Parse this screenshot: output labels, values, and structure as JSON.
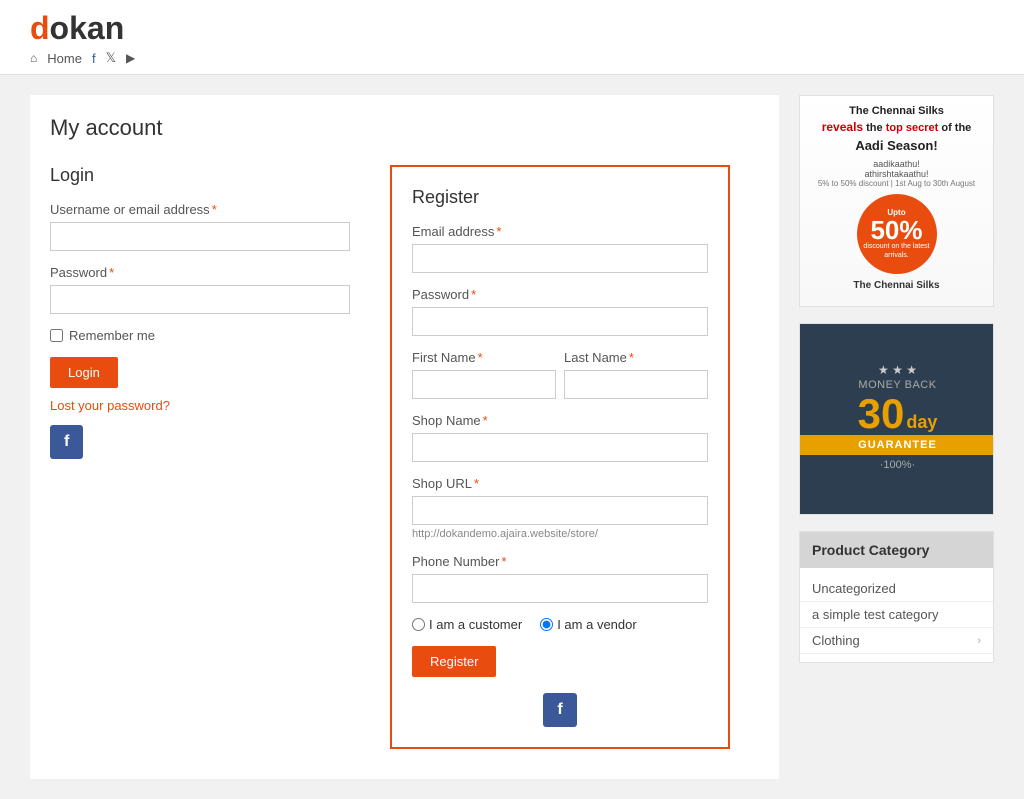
{
  "site": {
    "logo_prefix": "d",
    "logo_suffix": "okan"
  },
  "nav": {
    "home_label": "Home",
    "icons": [
      "home-icon",
      "facebook-nav-icon",
      "twitter-nav-icon",
      "youtube-nav-icon"
    ]
  },
  "page": {
    "title": "My account"
  },
  "login": {
    "section_title": "Login",
    "username_label": "Username or email address",
    "username_required": "*",
    "username_placeholder": "",
    "password_label": "Password",
    "password_required": "*",
    "password_placeholder": "",
    "remember_me_label": "Remember me",
    "login_button": "Login",
    "lost_password_link": "Lost your password?",
    "facebook_button": "f"
  },
  "register": {
    "section_title": "Register",
    "email_label": "Email address",
    "email_required": "*",
    "email_placeholder": "",
    "password_label": "Password",
    "password_required": "*",
    "password_placeholder": "",
    "first_name_label": "First Name",
    "first_name_required": "*",
    "first_name_placeholder": "",
    "last_name_label": "Last Name",
    "last_name_required": "*",
    "last_name_placeholder": "",
    "shop_name_label": "Shop Name",
    "shop_name_required": "*",
    "shop_name_placeholder": "",
    "shop_url_label": "Shop URL",
    "shop_url_required": "*",
    "shop_url_placeholder": "",
    "shop_url_hint": "http://dokandemo.ajaira.website/store/",
    "phone_label": "Phone Number",
    "phone_required": "*",
    "phone_placeholder": "",
    "customer_label": "I am a customer",
    "vendor_label": "I am a vendor",
    "register_button": "Register",
    "facebook_button": "f"
  },
  "sidebar": {
    "ad_top": {
      "headline1": "The Chennai Silks",
      "headline2": "reveals",
      "headline3": "the top",
      "headline4": "secret",
      "headline5": "of the",
      "headline6": "Aadi Season!",
      "subtext1": "aadikaathu!",
      "subtext2": "athirshtakaathu!",
      "discount_percent": "50%",
      "discount_label": "discount on the latest arrivals.",
      "brand": "The Chennai Silks"
    },
    "ad_guarantee": {
      "days": "30",
      "day_label": "day",
      "money_back": "MONEY BACK",
      "guarantee": "GUARANTEE",
      "percent": "·100%·",
      "stars": "★ ★ ★"
    },
    "product_category": {
      "title": "Product Category",
      "items": [
        {
          "label": "Uncategorized",
          "has_arrow": false
        },
        {
          "label": "a simple test category",
          "has_arrow": false
        },
        {
          "label": "Clothing",
          "has_arrow": true
        }
      ]
    }
  }
}
